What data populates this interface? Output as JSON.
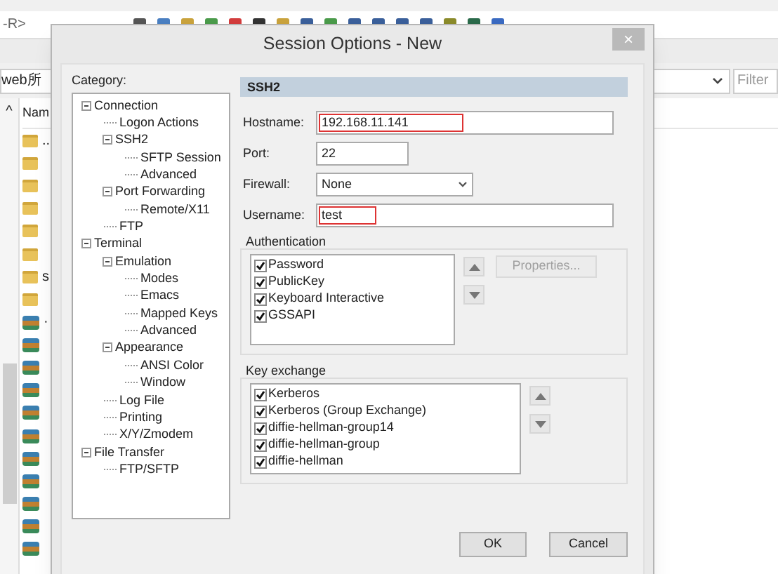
{
  "background": {
    "toolbar_text": "-R>",
    "path_field": {
      "value": "web所"
    },
    "filter_field": {
      "placeholder": "Filter"
    },
    "scroll_up": "^",
    "column_header": "Nam",
    "files": [
      {
        "kind": "folder",
        "name": ".."
      },
      {
        "kind": "folder"
      },
      {
        "kind": "folder"
      },
      {
        "kind": "folder"
      },
      {
        "kind": "folder"
      },
      {
        "kind": "folder"
      },
      {
        "kind": "folder",
        "name": "s"
      },
      {
        "kind": "folder"
      },
      {
        "kind": "archive",
        "name": "·"
      },
      {
        "kind": "archive"
      },
      {
        "kind": "archive"
      },
      {
        "kind": "archive"
      },
      {
        "kind": "archive"
      },
      {
        "kind": "archive"
      },
      {
        "kind": "archive"
      },
      {
        "kind": "archive"
      },
      {
        "kind": "archive"
      },
      {
        "kind": "archive"
      },
      {
        "kind": "archive"
      }
    ]
  },
  "dialog": {
    "title": "Session Options - New",
    "close": "×",
    "category_label": "Category:",
    "tree": [
      {
        "label": "Connection",
        "expanded": true,
        "children": [
          {
            "label": "Logon Actions"
          },
          {
            "label": "SSH2",
            "expanded": true,
            "children": [
              {
                "label": "SFTP Session"
              },
              {
                "label": "Advanced"
              }
            ]
          },
          {
            "label": "Port Forwarding",
            "expanded": true,
            "children": [
              {
                "label": "Remote/X11"
              }
            ]
          },
          {
            "label": "FTP"
          }
        ]
      },
      {
        "label": "Terminal",
        "expanded": true,
        "children": [
          {
            "label": "Emulation",
            "expanded": true,
            "children": [
              {
                "label": "Modes"
              },
              {
                "label": "Emacs"
              },
              {
                "label": "Mapped Keys"
              },
              {
                "label": "Advanced"
              }
            ]
          },
          {
            "label": "Appearance",
            "expanded": true,
            "children": [
              {
                "label": "ANSI Color"
              },
              {
                "label": "Window"
              }
            ]
          },
          {
            "label": "Log File"
          },
          {
            "label": "Printing"
          },
          {
            "label": "X/Y/Zmodem"
          }
        ]
      },
      {
        "label": "File Transfer",
        "expanded": true,
        "children": [
          {
            "label": "FTP/SFTP"
          }
        ]
      }
    ],
    "section_header": "SSH2",
    "fields": [
      {
        "kind": "text",
        "label": "Hostname:",
        "value": "192.168.11.141",
        "highlighted": true
      },
      {
        "kind": "short",
        "label": "Port:",
        "value": "22",
        "highlighted": false
      },
      {
        "kind": "select",
        "label": "Firewall:",
        "value": "None",
        "highlighted": false
      },
      {
        "kind": "text",
        "label": "Username:",
        "value": "test",
        "highlighted": true
      }
    ],
    "authentication": {
      "title": "Authentication",
      "items": [
        {
          "label": "Password",
          "checked": true
        },
        {
          "label": "PublicKey",
          "checked": true
        },
        {
          "label": "Keyboard Interactive",
          "checked": true
        },
        {
          "label": "GSSAPI",
          "checked": true
        }
      ],
      "properties_button": {
        "label": "Properties...",
        "disabled": true
      }
    },
    "key_exchange": {
      "title": "Key exchange",
      "items": [
        {
          "label": "Kerberos",
          "checked": true
        },
        {
          "label": "Kerberos (Group Exchange)",
          "checked": true
        },
        {
          "label": "diffie-hellman-group14",
          "checked": true
        },
        {
          "label": "diffie-hellman-group",
          "checked": true
        },
        {
          "label": "diffie-hellman",
          "checked": true
        }
      ]
    },
    "buttons": [
      "OK",
      "Cancel"
    ]
  }
}
